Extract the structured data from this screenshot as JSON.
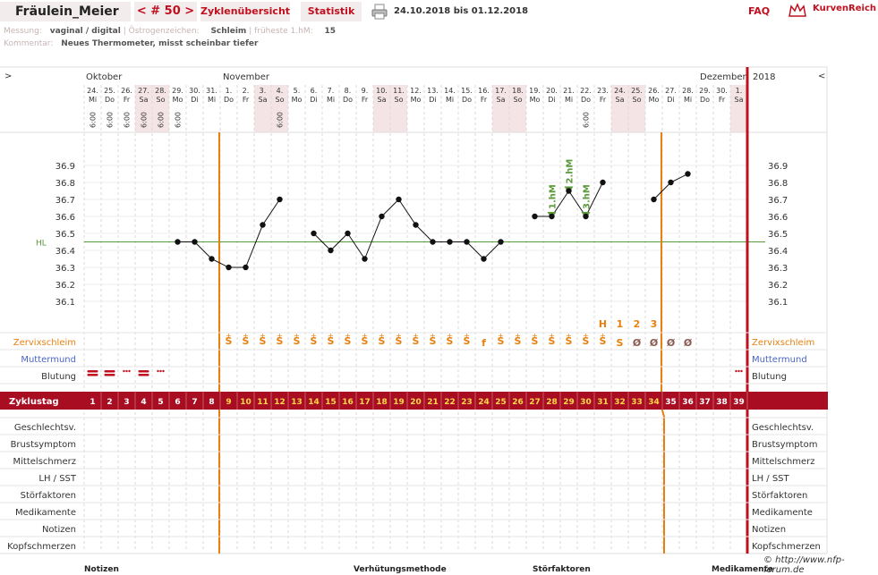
{
  "header": {
    "user_name": "Fräulein_Meier",
    "cycle_number": "< # 50 >",
    "tab_overview": "Zyklenübersicht",
    "tab_statistics": "Statistik",
    "date_range": "24.10.2018 bis 01.12.2018",
    "faq": "FAQ",
    "brand": "KurvenReich"
  },
  "info": {
    "measurement_label": "Messung:",
    "measurement_value": "vaginal / digital",
    "estrogen_label": "Östrogenzeichen:",
    "estrogen_value": "Schleim",
    "earliest_label": "früheste 1.hM:",
    "earliest_value": "15",
    "comment_label": "Kommentar:",
    "comment_value": "Neues Thermometer, misst scheinbar tiefer"
  },
  "nav": {
    "prev": ">",
    "next": "<"
  },
  "months": [
    "Oktober",
    "November",
    "Dezember"
  ],
  "year": "2018",
  "days": [
    {
      "num": "24.",
      "wd": "Mi",
      "time": "6:00"
    },
    {
      "num": "25.",
      "wd": "Do",
      "time": "6:00"
    },
    {
      "num": "26.",
      "wd": "Fr",
      "time": "6:00"
    },
    {
      "num": "27.",
      "wd": "Sa",
      "time": "6:00"
    },
    {
      "num": "28.",
      "wd": "So",
      "time": "6:00"
    },
    {
      "num": "29.",
      "wd": "Mo",
      "time": "6:00"
    },
    {
      "num": "30.",
      "wd": "Di",
      "time": ""
    },
    {
      "num": "31.",
      "wd": "Mi",
      "time": ""
    },
    {
      "num": "1.",
      "wd": "Do",
      "time": ""
    },
    {
      "num": "2.",
      "wd": "Fr",
      "time": ""
    },
    {
      "num": "3.",
      "wd": "Sa",
      "time": ""
    },
    {
      "num": "4.",
      "wd": "So",
      "time": "6:00"
    },
    {
      "num": "5.",
      "wd": "Mo",
      "time": ""
    },
    {
      "num": "6.",
      "wd": "Di",
      "time": ""
    },
    {
      "num": "7.",
      "wd": "Mi",
      "time": ""
    },
    {
      "num": "8.",
      "wd": "Do",
      "time": ""
    },
    {
      "num": "9.",
      "wd": "Fr",
      "time": ""
    },
    {
      "num": "10.",
      "wd": "Sa",
      "time": ""
    },
    {
      "num": "11.",
      "wd": "So",
      "time": ""
    },
    {
      "num": "12.",
      "wd": "Mo",
      "time": ""
    },
    {
      "num": "13.",
      "wd": "Di",
      "time": ""
    },
    {
      "num": "14.",
      "wd": "Mi",
      "time": ""
    },
    {
      "num": "15.",
      "wd": "Do",
      "time": ""
    },
    {
      "num": "16.",
      "wd": "Fr",
      "time": ""
    },
    {
      "num": "17.",
      "wd": "Sa",
      "time": ""
    },
    {
      "num": "18.",
      "wd": "So",
      "time": ""
    },
    {
      "num": "19.",
      "wd": "Mo",
      "time": ""
    },
    {
      "num": "20.",
      "wd": "Di",
      "time": ""
    },
    {
      "num": "21.",
      "wd": "Mi",
      "time": ""
    },
    {
      "num": "22.",
      "wd": "Do",
      "time": "6:00"
    },
    {
      "num": "23.",
      "wd": "Fr",
      "time": ""
    },
    {
      "num": "24.",
      "wd": "Sa",
      "time": ""
    },
    {
      "num": "25.",
      "wd": "So",
      "time": ""
    },
    {
      "num": "26.",
      "wd": "Mo",
      "time": ""
    },
    {
      "num": "27.",
      "wd": "Di",
      "time": ""
    },
    {
      "num": "28.",
      "wd": "Mi",
      "time": ""
    },
    {
      "num": "29.",
      "wd": "Do",
      "time": ""
    },
    {
      "num": "30.",
      "wd": "Fr",
      "time": ""
    },
    {
      "num": "1.",
      "wd": "Sa",
      "time": ""
    }
  ],
  "chart_data": {
    "type": "line",
    "ylim": [
      36.0,
      37.0
    ],
    "yticks": [
      "36.9",
      "36.8",
      "36.7",
      "36.6",
      "36.5",
      "36.4",
      "36.3",
      "36.2",
      "36.1"
    ],
    "hl_label": "HL",
    "hl_value": 36.45,
    "temperatures": [
      null,
      null,
      null,
      null,
      null,
      36.45,
      36.45,
      36.35,
      36.3,
      36.3,
      36.55,
      36.7,
      null,
      36.5,
      36.4,
      36.5,
      36.35,
      36.6,
      36.7,
      36.55,
      36.45,
      36.45,
      36.45,
      36.35,
      36.45,
      null,
      36.6,
      36.6,
      36.75,
      36.6,
      36.8,
      null,
      null,
      36.7,
      36.8,
      36.85,
      null,
      null,
      null
    ],
    "high_markers": [
      {
        "day": 27,
        "label": "1.hM"
      },
      {
        "day": 28,
        "label": "2.hM"
      },
      {
        "day": 29,
        "label": "3.hM"
      }
    ]
  },
  "mucus_count_labels": [
    "H",
    "1",
    "2",
    "3"
  ],
  "mucus": [
    "",
    "",
    "",
    "",
    "",
    "",
    "",
    "",
    "S+",
    "S+",
    "S+",
    "S+",
    "S+",
    "S+",
    "S+",
    "S+",
    "S+",
    "S+",
    "S+",
    "S+",
    "S+",
    "S+",
    "S+",
    "f",
    "S+",
    "S+",
    "S+",
    "S+",
    "S+",
    "S+",
    "S+",
    "S",
    "Ø",
    "Ø",
    "Ø",
    "Ø",
    "",
    ""
  ],
  "bleeding": [
    2,
    2,
    1,
    2,
    1,
    0,
    0,
    0,
    0,
    0,
    0,
    0,
    0,
    0,
    0,
    0,
    0,
    0,
    0,
    0,
    0,
    0,
    0,
    0,
    0,
    0,
    0,
    0,
    0,
    0,
    0,
    0,
    0,
    0,
    0,
    0,
    0,
    0,
    1
  ],
  "rows": {
    "cervical_mucus": "Zervixschleim",
    "cervix": "Muttermund",
    "bleeding": "Blutung",
    "cycle_day": "Zyklustag",
    "intercourse": "Geschlechtsv.",
    "breast": "Brustsymptom",
    "midpain": "Mittelschmerz",
    "lh": "LH / SST",
    "disturbances": "Störfaktoren",
    "medication": "Medikamente",
    "notes": "Notizen",
    "headache": "Kopfschmerzen"
  },
  "cycle_days": [
    "1",
    "2",
    "3",
    "4",
    "5",
    "6",
    "7",
    "8",
    "9",
    "10",
    "11",
    "12",
    "13",
    "14",
    "15",
    "16",
    "17",
    "18",
    "19",
    "20",
    "21",
    "22",
    "23",
    "24",
    "25",
    "26",
    "27",
    "28",
    "29",
    "30",
    "31",
    "32",
    "33",
    "34",
    "35",
    "36",
    "37",
    "38",
    "39"
  ],
  "footer": {
    "copyright": "© http://www.nfp-forum.de",
    "notes": "Notizen",
    "contraception": "Verhütungsmethode",
    "disturbances": "Störfaktoren",
    "medication": "Medikamente"
  },
  "colors": {
    "accent": "#c0101f",
    "orange": "#e8800f",
    "weekend": "#f5e4e6",
    "band": "#a80d22",
    "hl": "#5a9a3a"
  }
}
